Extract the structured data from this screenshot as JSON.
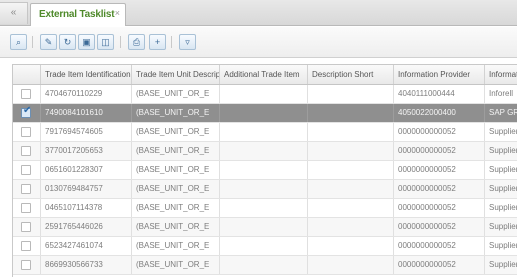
{
  "tabs": {
    "prev_tab_label": "« ",
    "active_tab_label": "External Tasklist",
    "close_glyph": "×"
  },
  "toolbar": {
    "icons": [
      "search-icon",
      "edit-icon",
      "refresh-icon",
      "window-icon",
      "delete-icon",
      "print-icon",
      "add-icon",
      "filter-icon"
    ]
  },
  "grid": {
    "columns": [
      "",
      "Trade Item Identification",
      "Trade Item Unit Descriptor",
      "Additional Trade Item",
      "Description Short",
      "Information Provider",
      "Information"
    ],
    "rows": [
      {
        "checked": false,
        "selected": false,
        "gtin": "4704670110229",
        "unit": "(BASE_UNIT_OR_E",
        "provider": "4040111000444",
        "info": "Inforell"
      },
      {
        "checked": true,
        "selected": true,
        "gtin": "7490084101610",
        "unit": "(BASE_UNIT_OR_E",
        "provider": "4050022000400",
        "info": "SAP GR"
      },
      {
        "checked": false,
        "selected": false,
        "gtin": "7917694574605",
        "unit": "(BASE_UNIT_OR_E",
        "provider": "0000000000052",
        "info": "Supplier"
      },
      {
        "checked": false,
        "selected": false,
        "gtin": "3770017205653",
        "unit": "(BASE_UNIT_OR_E",
        "provider": "0000000000052",
        "info": "Supplier"
      },
      {
        "checked": false,
        "selected": false,
        "gtin": "0651601228307",
        "unit": "(BASE_UNIT_OR_E",
        "provider": "0000000000052",
        "info": "Supplier"
      },
      {
        "checked": false,
        "selected": false,
        "gtin": "0130769484757",
        "unit": "(BASE_UNIT_OR_E",
        "provider": "0000000000052",
        "info": "Supplier"
      },
      {
        "checked": false,
        "selected": false,
        "gtin": "0465107114378",
        "unit": "(BASE_UNIT_OR_E",
        "provider": "0000000000052",
        "info": "Supplier"
      },
      {
        "checked": false,
        "selected": false,
        "gtin": "2591765446026",
        "unit": "(BASE_UNIT_OR_E",
        "provider": "0000000000052",
        "info": "Supplier"
      },
      {
        "checked": false,
        "selected": false,
        "gtin": "6523427461074",
        "unit": "(BASE_UNIT_OR_E",
        "provider": "0000000000052",
        "info": "Supplier"
      },
      {
        "checked": false,
        "selected": false,
        "gtin": "8669930566733",
        "unit": "(BASE_UNIT_OR_E",
        "provider": "0000000000052",
        "info": "Supplier"
      }
    ]
  },
  "colors": {
    "tab_title": "#4f8a2b",
    "selected_row": "#8f8f8f",
    "checkbox_tick": "#2d6aa8"
  }
}
